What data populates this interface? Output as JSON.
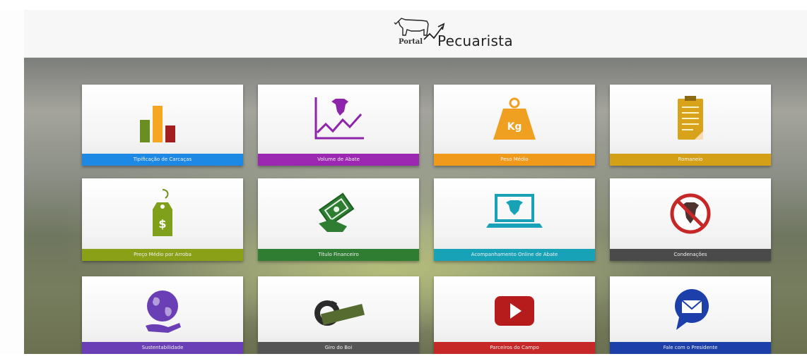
{
  "header": {
    "logo_small": "Portal",
    "logo_big": "Pecuarista"
  },
  "tiles": [
    {
      "label": "Tipificação de Carcaças",
      "color": "#1e88e5",
      "icon": "bar-chart-icon"
    },
    {
      "label": "Volume de Abate",
      "color": "#9c27b0",
      "icon": "cattle-line-chart-icon"
    },
    {
      "label": "Peso Médio",
      "color": "#ef9a1a",
      "icon": "kg-weight-icon"
    },
    {
      "label": "Romaneio",
      "color": "#d4a017",
      "icon": "clipboard-icon"
    },
    {
      "label": "Preço Médio por Arroba",
      "color": "#8aa016",
      "icon": "price-tag-icon"
    },
    {
      "label": "Título Financeiro",
      "color": "#2e7d32",
      "icon": "money-hand-icon"
    },
    {
      "label": "Acompanhamento Online de Abate",
      "color": "#17a2b8",
      "icon": "laptop-cattle-icon"
    },
    {
      "label": "Condenações",
      "color": "#4a4a4a",
      "icon": "prohibited-cattle-icon"
    },
    {
      "label": "Sustentabilidade",
      "color": "#6a3fb5",
      "icon": "globe-hand-icon"
    },
    {
      "label": "Giro do Boi",
      "color": "#555555",
      "icon": "giro-do-boi-logo-icon"
    },
    {
      "label": "Parceiros do Campo",
      "color": "#c62828",
      "icon": "video-play-icon"
    },
    {
      "label": "Fale com o Presidente",
      "color": "#1c3faa",
      "icon": "mail-bubble-icon"
    }
  ]
}
